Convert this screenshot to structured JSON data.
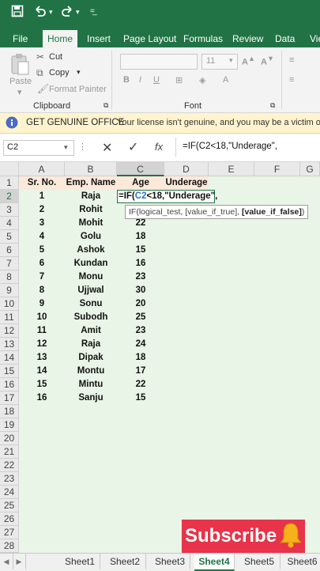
{
  "ribbon_tabs": [
    "File",
    "Home",
    "Insert",
    "Page Layout",
    "Formulas",
    "Review",
    "Data",
    "View"
  ],
  "active_tab": "Home",
  "clipboard": {
    "cut": "Cut",
    "copy": "Copy",
    "paste": "Paste",
    "format_painter": "Format Painter",
    "group_label": "Clipboard"
  },
  "font": {
    "size": "11",
    "group_label": "Font"
  },
  "license_bar": {
    "title": "GET GENUINE OFFICE",
    "message": "Your license isn't genuine, and you may be a victim of"
  },
  "formula_bar": {
    "name_box": "C2",
    "fx": "fx",
    "formula": "=IF(C2<18,\"Underage\","
  },
  "columns": [
    "A",
    "B",
    "C",
    "D",
    "E",
    "F",
    "G"
  ],
  "headers": {
    "sr": "Sr. No.",
    "name": "Emp. Name",
    "age": "Age",
    "underage": "Underage"
  },
  "rows": [
    {
      "sr": "1",
      "name": "Raja",
      "age": ""
    },
    {
      "sr": "2",
      "name": "Rohit",
      "age": ""
    },
    {
      "sr": "3",
      "name": "Mohit",
      "age": "22"
    },
    {
      "sr": "4",
      "name": "Golu",
      "age": "18"
    },
    {
      "sr": "5",
      "name": "Ashok",
      "age": "15"
    },
    {
      "sr": "6",
      "name": "Kundan",
      "age": "16"
    },
    {
      "sr": "7",
      "name": "Monu",
      "age": "23"
    },
    {
      "sr": "8",
      "name": "Ujjwal",
      "age": "30"
    },
    {
      "sr": "9",
      "name": "Sonu",
      "age": "20"
    },
    {
      "sr": "10",
      "name": "Subodh",
      "age": "25"
    },
    {
      "sr": "11",
      "name": "Amit",
      "age": "23"
    },
    {
      "sr": "12",
      "name": "Raja",
      "age": "24"
    },
    {
      "sr": "13",
      "name": "Dipak",
      "age": "18"
    },
    {
      "sr": "14",
      "name": "Montu",
      "age": "17"
    },
    {
      "sr": "15",
      "name": "Mintu",
      "age": "22"
    },
    {
      "sr": "16",
      "name": "Sanju",
      "age": "15"
    }
  ],
  "row_numbers": [
    "1",
    "2",
    "3",
    "4",
    "5",
    "6",
    "7",
    "8",
    "9",
    "10",
    "11",
    "12",
    "13",
    "14",
    "15",
    "16",
    "17",
    "18",
    "19",
    "20",
    "21",
    "22",
    "23",
    "24",
    "25",
    "26",
    "27",
    "28"
  ],
  "edit_cell": {
    "part1": "=IF(",
    "ref": "C2",
    "part2": "<18,\"Underage\","
  },
  "tooltip": {
    "text": "IF(logical_test, [value_if_true], ",
    "bold": "[value_if_false]",
    "end": ")"
  },
  "sheets": [
    "Sheet1",
    "Sheet2",
    "Sheet3",
    "Sheet4",
    "Sheet5",
    "Sheet6"
  ],
  "active_sheet": "Sheet4",
  "subscribe": "Subscribe",
  "colors": {
    "excel_green": "#217346",
    "header_fill": "#fde9d9",
    "grid_bg": "#e9f5e6",
    "subscribe_bg": "#e8334a",
    "formula_ref": "#2f6fd1"
  }
}
